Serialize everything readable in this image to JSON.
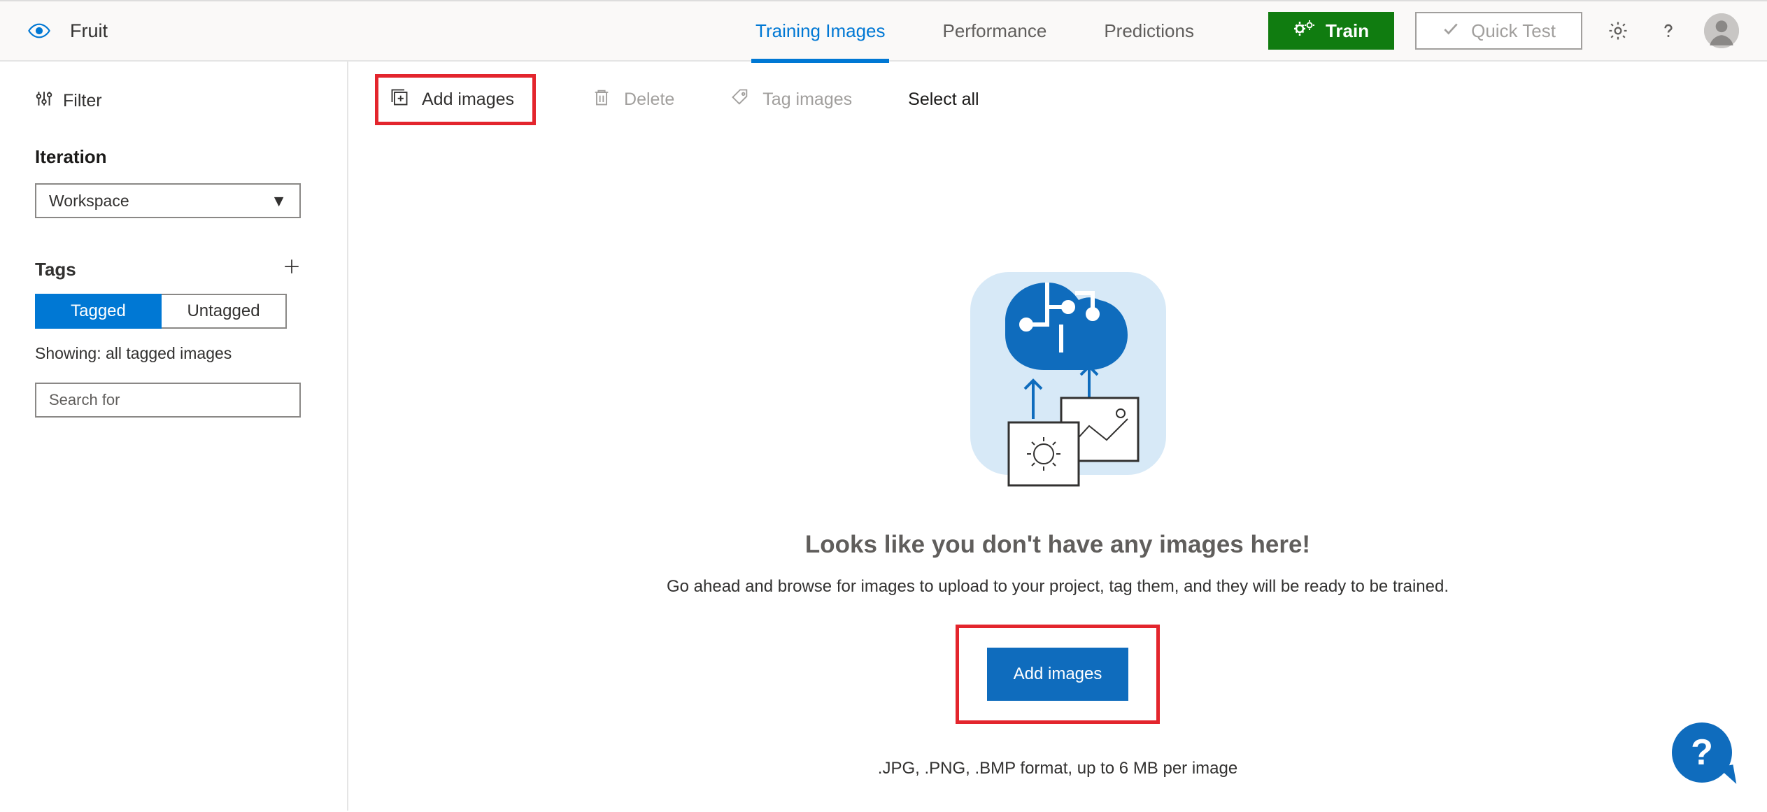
{
  "header": {
    "project_title": "Fruit",
    "tabs": {
      "training_images": "Training Images",
      "performance": "Performance",
      "predictions": "Predictions"
    },
    "train_label": "Train",
    "quicktest_label": "Quick Test"
  },
  "sidebar": {
    "filter_label": "Filter",
    "iteration_heading": "Iteration",
    "iteration_selected": "Workspace",
    "tags_heading": "Tags",
    "tagged_label": "Tagged",
    "untagged_label": "Untagged",
    "showing_text": "Showing: all tagged images",
    "search_placeholder": "Search for"
  },
  "toolbar": {
    "add_images": "Add images",
    "delete": "Delete",
    "tag_images": "Tag images",
    "select_all": "Select all"
  },
  "empty": {
    "title": "Looks like you don't have any images here!",
    "desc": "Go ahead and browse for images to upload to your project, tag them, and they will be ready to be trained.",
    "add_button": "Add images",
    "format": ".JPG, .PNG, .BMP format, up to 6 MB per image"
  },
  "fab": {
    "label": "?"
  }
}
